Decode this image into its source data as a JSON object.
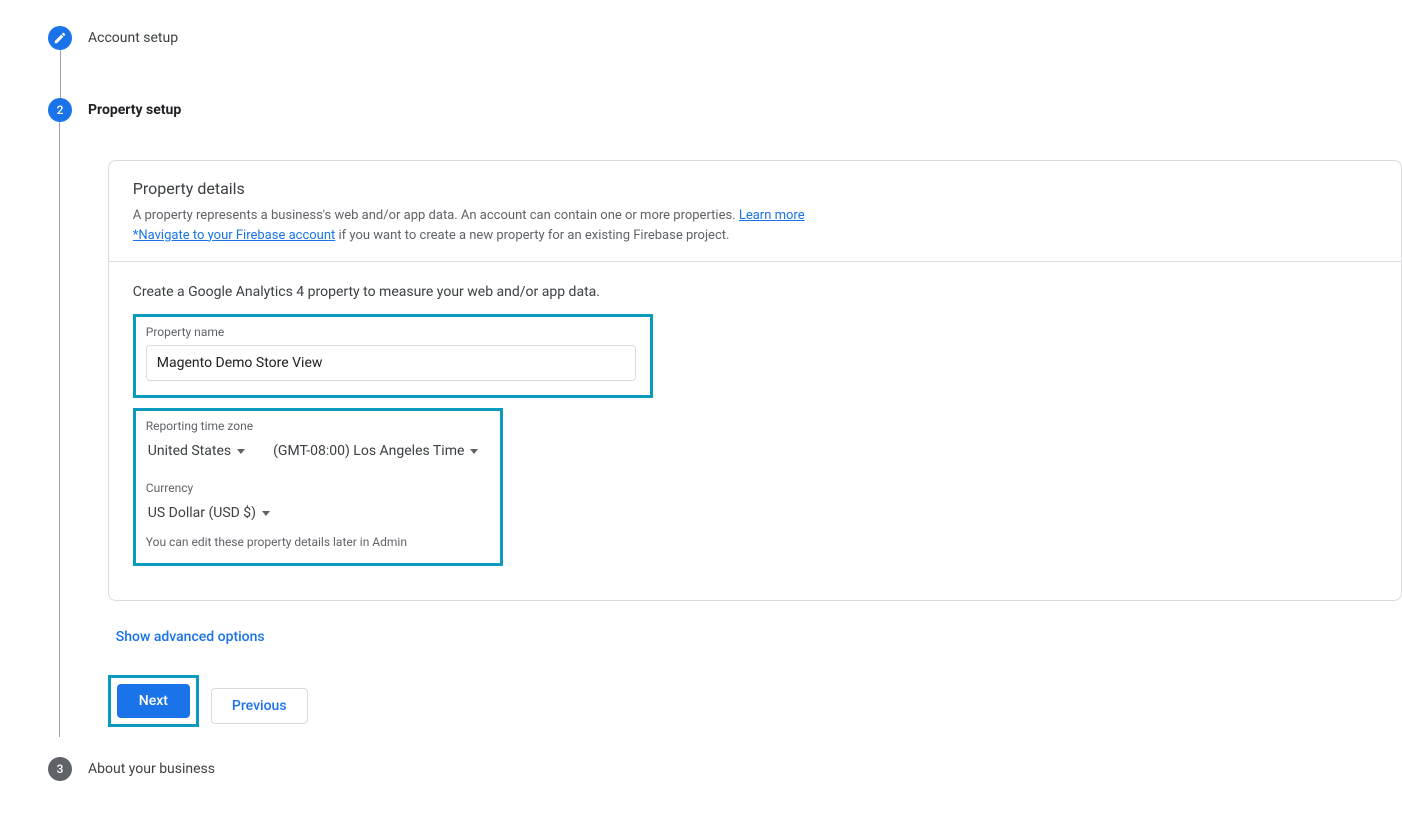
{
  "steps": {
    "s1": {
      "label": "Account setup"
    },
    "s2": {
      "num": "2",
      "label": "Property setup"
    },
    "s3": {
      "num": "3",
      "label": "About your business"
    }
  },
  "panel": {
    "title": "Property details",
    "desc_prefix": "A property represents a business's web and/or app data. An account can contain one or more properties. ",
    "learn_more": "Learn more",
    "firebase_link": "*Navigate to your Firebase account",
    "desc_suffix": " if you want to create a new property for an existing Firebase project."
  },
  "body": {
    "intro": "Create a Google Analytics 4 property to measure your web and/or app data.",
    "name_label": "Property name",
    "name_value": "Magento Demo Store View",
    "tz_label": "Reporting time zone",
    "country": "United States",
    "tz": "(GMT-08:00) Los Angeles Time",
    "currency_label": "Currency",
    "currency": "US Dollar (USD $)",
    "hint": "You can edit these property details later in Admin"
  },
  "adv": "Show advanced options",
  "buttons": {
    "next": "Next",
    "prev": "Previous"
  }
}
